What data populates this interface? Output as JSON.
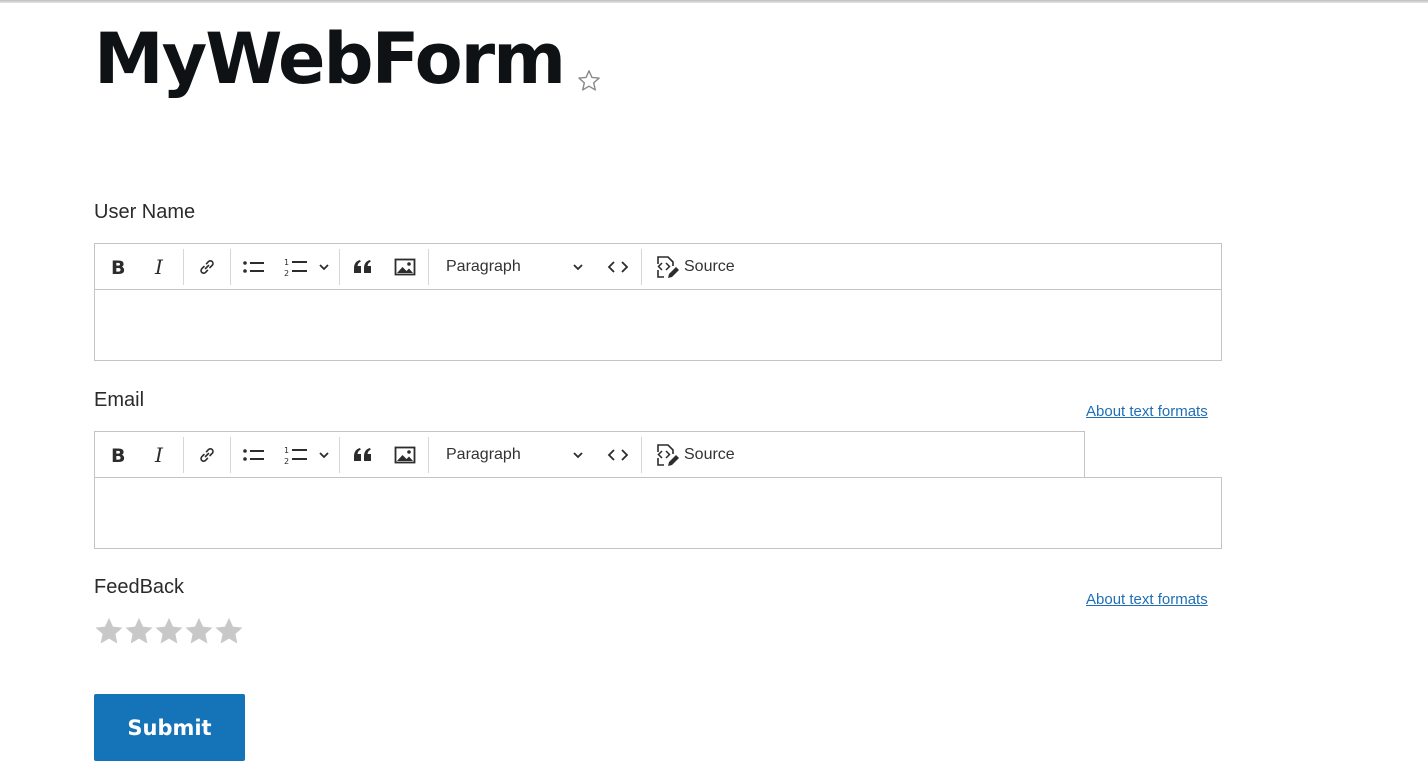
{
  "page": {
    "title": "MyWebForm",
    "favorite_icon": "star-outline-icon"
  },
  "fields": [
    {
      "label": "User Name"
    },
    {
      "label": "Email"
    },
    {
      "label": "FeedBack"
    }
  ],
  "about_text_formats": "About text formats",
  "toolbar": {
    "heading_value": "Paragraph",
    "source_label": "Source",
    "icons": [
      "bold-icon",
      "italic-icon",
      "link-icon",
      "bulleted-list-icon",
      "numbered-list-icon",
      "chevron-down-icon",
      "block-quote-icon",
      "image-icon",
      "code-icon",
      "source-icon"
    ]
  },
  "feedback": {
    "max_stars": 5,
    "selected": 0,
    "star_color": "#c8c8c8"
  },
  "submit_label": "Submit",
  "colors": {
    "accent": "#1574b8",
    "link": "#1f6fb5"
  }
}
